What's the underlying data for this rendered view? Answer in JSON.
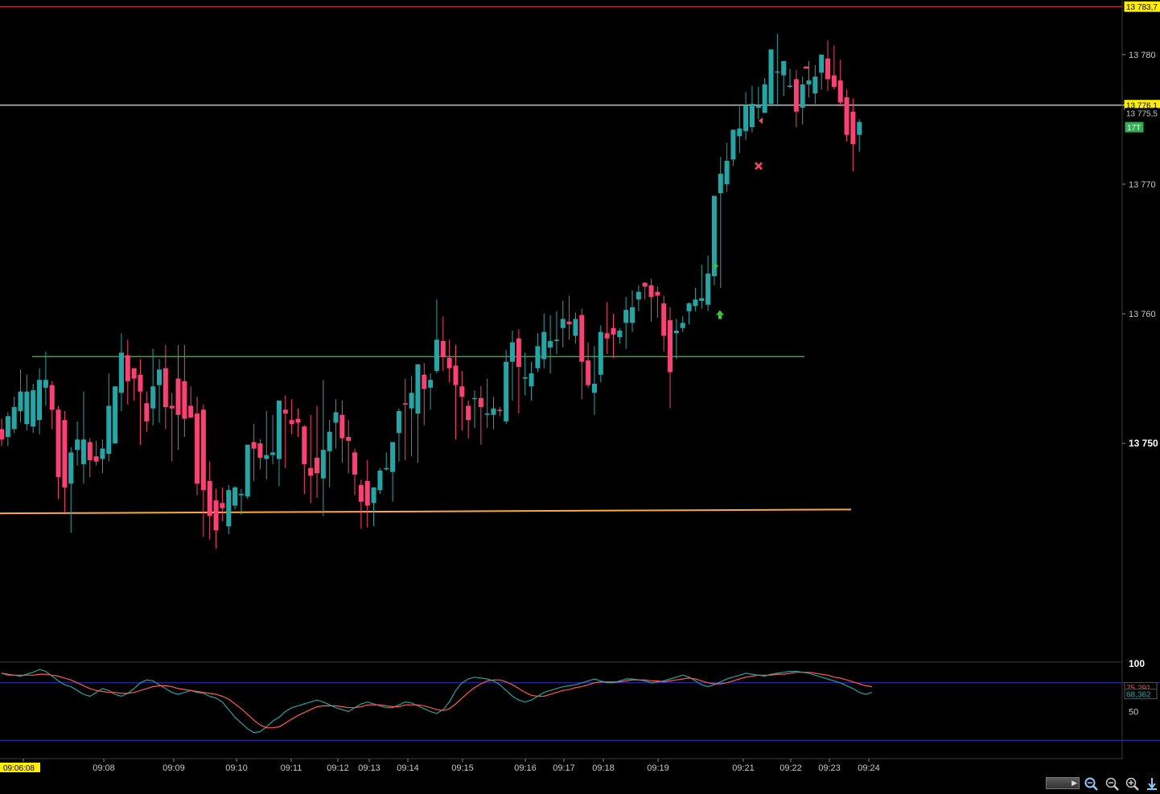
{
  "chart_data": {
    "type": "candlestick",
    "price_axis": {
      "ylim": [
        13733.5,
        13783.9
      ],
      "ticks": [
        {
          "value": 13780,
          "label": "13 780"
        },
        {
          "value": 13770,
          "label": "13 770"
        },
        {
          "value": 13760,
          "label": "13 760"
        },
        {
          "value": 13750,
          "label": "13 750",
          "bold": true
        }
      ],
      "tags": [
        {
          "value": 13783.7,
          "label": "13 783,7",
          "bg": "#ffee00",
          "fg": "#000000"
        },
        {
          "value": 13776.1,
          "label": "13 776,1",
          "bg": "#ffee00",
          "fg": "#000000"
        },
        {
          "value": 13775.5,
          "label": "13 775,5",
          "bg": "#000000",
          "fg": "#c8c8c8"
        },
        {
          "value": 13774.4,
          "label": "17T",
          "bg": "#33aa55",
          "fg": "#ffffff"
        }
      ]
    },
    "time_axis": {
      "labels": [
        "09:06:08",
        "09:08",
        "09:09",
        "09:10",
        "09:11",
        "09:12",
        "09:13",
        "09:14",
        "09:15",
        "09:16",
        "09:17",
        "09:18",
        "09:19",
        "09:21",
        "09:22",
        "09:23",
        "09:24"
      ],
      "first_label_bg": "#ffee00"
    },
    "candles": [
      [
        13751.1,
        13751.9,
        13749.8,
        13750.3
      ],
      [
        13750.5,
        13752.4,
        13749.8,
        13752.1
      ],
      [
        13751.1,
        13753.6,
        13750.8,
        13752.8
      ],
      [
        13752.5,
        13755.7,
        13751.6,
        13754.0
      ],
      [
        13751.5,
        13755.3,
        13751.0,
        13754.0
      ],
      [
        13751.3,
        13754.6,
        13750.8,
        13754.1
      ],
      [
        13751.8,
        13755.8,
        13750.7,
        13754.9
      ],
      [
        13754.3,
        13757.1,
        13752.9,
        13754.9
      ],
      [
        13754.5,
        13754.8,
        13751.1,
        13752.6
      ],
      [
        13752.6,
        13752.9,
        13745.7,
        13747.4
      ],
      [
        13751.8,
        13752.5,
        13744.7,
        13746.6
      ],
      [
        13746.9,
        13749.7,
        13743.1,
        13749.3
      ],
      [
        13749.5,
        13751.7,
        13748.3,
        13750.3
      ],
      [
        13748.4,
        13754.0,
        13746.9,
        13750.3
      ],
      [
        13750.1,
        13750.4,
        13747.4,
        13748.7
      ],
      [
        13749.0,
        13750.2,
        13748.3,
        13748.6
      ],
      [
        13748.8,
        13750.3,
        13747.7,
        13749.6
      ],
      [
        13749.2,
        13755.4,
        13748.6,
        13752.9
      ],
      [
        13750.0,
        13754.3,
        13750.0,
        13754.4
      ],
      [
        13753.9,
        13758.5,
        13752.5,
        13757.0
      ],
      [
        13756.8,
        13758.0,
        13753.0,
        13754.8
      ],
      [
        13755.8,
        13755.8,
        13753.3,
        13755.0
      ],
      [
        13755.3,
        13756.5,
        13749.9,
        13754.0
      ],
      [
        13753.1,
        13754.0,
        13750.9,
        13751.7
      ],
      [
        13752.7,
        13757.3,
        13751.4,
        13754.4
      ],
      [
        13754.5,
        13756.5,
        13751.6,
        13755.7
      ],
      [
        13755.8,
        13757.6,
        13751.1,
        13752.8
      ],
      [
        13752.9,
        13753.9,
        13748.6,
        13752.7
      ],
      [
        13755.0,
        13757.6,
        13749.5,
        13752.2
      ],
      [
        13754.8,
        13757.6,
        13750.5,
        13751.9
      ],
      [
        13752.9,
        13754.4,
        13752.0,
        13752.0
      ],
      [
        13752.3,
        13753.6,
        13746.0,
        13746.9
      ],
      [
        13752.6,
        13753.0,
        13742.8,
        13746.4
      ],
      [
        13747.1,
        13748.6,
        13742.6,
        13744.4
      ],
      [
        13745.6,
        13746.5,
        13741.9,
        13743.3
      ],
      [
        13745.4,
        13746.6,
        13744.0,
        13745.0
      ],
      [
        13743.6,
        13746.8,
        13743.0,
        13746.4
      ],
      [
        13745.2,
        13746.7,
        13744.9,
        13746.6
      ],
      [
        13746.0,
        13746.5,
        13744.5,
        13746.1
      ],
      [
        13745.9,
        13748.3,
        13745.7,
        13749.9
      ],
      [
        13750.1,
        13751.5,
        13747.1,
        13749.6
      ],
      [
        13750.0,
        13750.3,
        13748.0,
        13748.9
      ],
      [
        13748.8,
        13752.5,
        13747.2,
        13749.1
      ],
      [
        13749.1,
        13752.2,
        13748.4,
        13749.3
      ],
      [
        13748.8,
        13753.2,
        13746.7,
        13753.3
      ],
      [
        13752.6,
        13753.7,
        13748.1,
        13752.3
      ],
      [
        13751.8,
        13753.4,
        13750.7,
        13751.5
      ],
      [
        13751.9,
        13752.7,
        13750.5,
        13751.6
      ],
      [
        13751.3,
        13751.4,
        13746.1,
        13748.4
      ],
      [
        13748.1,
        13752.2,
        13745.4,
        13747.5
      ],
      [
        13748.9,
        13752.9,
        13745.8,
        13747.7
      ],
      [
        13747.3,
        13754.9,
        13744.4,
        13749.5
      ],
      [
        13749.4,
        13751.8,
        13746.6,
        13750.9
      ],
      [
        13751.6,
        13753.4,
        13749.6,
        13752.4
      ],
      [
        13752.2,
        13753.3,
        13748.5,
        13750.4
      ],
      [
        13750.5,
        13751.8,
        13747.7,
        13750.2
      ],
      [
        13749.3,
        13749.6,
        13746.0,
        13747.6
      ],
      [
        13746.8,
        13747.2,
        13743.4,
        13745.5
      ],
      [
        13747.1,
        13748.7,
        13743.5,
        13745.2
      ],
      [
        13745.4,
        13746.5,
        13743.6,
        13746.6
      ],
      [
        13746.4,
        13748.1,
        13746.1,
        13747.9
      ],
      [
        13748.0,
        13749.3,
        13747.9,
        13748.1
      ],
      [
        13747.8,
        13750.1,
        13745.5,
        13750.1
      ],
      [
        13750.8,
        13752.7,
        13748.6,
        13752.5
      ],
      [
        13753.1,
        13755.0,
        13748.7,
        13753.0
      ],
      [
        13752.7,
        13755.2,
        13749.0,
        13753.9
      ],
      [
        13752.3,
        13756.1,
        13748.5,
        13756.1
      ],
      [
        13755.3,
        13756.2,
        13751.4,
        13754.2
      ],
      [
        13754.3,
        13755.4,
        13752.6,
        13754.9
      ],
      [
        13755.6,
        13761.1,
        13755.4,
        13758.0
      ],
      [
        13757.9,
        13759.8,
        13755.6,
        13756.7
      ],
      [
        13756.6,
        13758.0,
        13754.7,
        13755.8
      ],
      [
        13756.0,
        13757.6,
        13750.3,
        13754.5
      ],
      [
        13754.4,
        13755.6,
        13751.0,
        13753.6
      ],
      [
        13752.9,
        13753.3,
        13750.4,
        13751.8
      ],
      [
        13753.5,
        13754.1,
        13751.2,
        13753.5
      ],
      [
        13753.5,
        13754.4,
        13749.9,
        13752.8
      ],
      [
        13752.2,
        13755.0,
        13751.2,
        13752.3
      ],
      [
        13752.2,
        13753.6,
        13751.1,
        13752.7
      ],
      [
        13752.6,
        13752.8,
        13752.1,
        13752.5
      ],
      [
        13751.7,
        13757.2,
        13751.5,
        13756.3
      ],
      [
        13756.3,
        13758.7,
        13753.3,
        13757.8
      ],
      [
        13758.1,
        13758.8,
        13752.3,
        13755.9
      ],
      [
        13755.0,
        13757.0,
        13753.7,
        13755.1
      ],
      [
        13754.4,
        13756.3,
        13753.3,
        13755.4
      ],
      [
        13755.8,
        13758.5,
        13755.5,
        13757.5
      ],
      [
        13756.5,
        13760.0,
        13755.8,
        13758.6
      ],
      [
        13757.4,
        13759.9,
        13755.4,
        13757.9
      ],
      [
        13757.9,
        13760.2,
        13756.9,
        13758.0
      ],
      [
        13758.9,
        13761.0,
        13757.4,
        13759.6
      ],
      [
        13759.4,
        13761.4,
        13758.0,
        13759.2
      ],
      [
        13758.3,
        13760.1,
        13757.7,
        13759.6
      ],
      [
        13759.9,
        13760.4,
        13753.4,
        13756.3
      ],
      [
        13756.4,
        13757.8,
        13754.3,
        13754.5
      ],
      [
        13753.9,
        13757.5,
        13752.2,
        13754.6
      ],
      [
        13755.3,
        13759.1,
        13754.7,
        13758.6
      ],
      [
        13758.5,
        13760.9,
        13756.9,
        13758.1
      ],
      [
        13758.9,
        13760.0,
        13756.6,
        13758.4
      ],
      [
        13758.2,
        13758.9,
        13757.7,
        13758.7
      ],
      [
        13759.3,
        13761.3,
        13757.3,
        13760.3
      ],
      [
        13759.3,
        13761.8,
        13758.6,
        13760.5
      ],
      [
        13761.1,
        13762.2,
        13760.2,
        13761.7
      ],
      [
        13762.4,
        13762.2,
        13761.1,
        13762.1
      ],
      [
        13762.2,
        13762.7,
        13759.4,
        13761.3
      ],
      [
        13761.7,
        13762.1,
        13759.7,
        13761.4
      ],
      [
        13760.8,
        13761.4,
        13757.1,
        13758.3
      ],
      [
        13759.5,
        13760.5,
        13752.7,
        13755.5
      ],
      [
        13758.5,
        13759.6,
        13756.5,
        13758.7
      ],
      [
        13758.9,
        13759.8,
        13758.6,
        13759.3
      ],
      [
        13760.2,
        13760.9,
        13759.2,
        13760.8
      ],
      [
        13760.6,
        13762.0,
        13760.2,
        13761.1
      ],
      [
        13761.0,
        13763.8,
        13760.4,
        13761.2
      ],
      [
        13760.7,
        13764.5,
        13760.2,
        13763.1
      ],
      [
        13762.9,
        13766.3,
        13762.2,
        13769.1
      ],
      [
        13769.3,
        13772.1,
        13762.0,
        13770.8
      ],
      [
        13770.0,
        13773.2,
        13769.4,
        13771.8
      ],
      [
        13771.9,
        13773.2,
        13771.4,
        13774.2
      ],
      [
        13773.7,
        13776.0,
        13772.4,
        13774.3
      ],
      [
        13774.1,
        13777.1,
        13773.4,
        13776.1
      ],
      [
        13774.4,
        13777.6,
        13774.0,
        13776.2
      ],
      [
        13775.9,
        13777.5,
        13775.0,
        13776.1
      ],
      [
        13775.5,
        13778.2,
        13775.5,
        13777.7
      ],
      [
        13776.2,
        13778.3,
        13776.0,
        13780.4
      ],
      [
        13778.7,
        13781.6,
        13776.0,
        13778.7
      ],
      [
        13778.4,
        13779.3,
        13776.8,
        13779.5
      ],
      [
        13777.6,
        13778.9,
        13777.4,
        13777.6
      ],
      [
        13778.1,
        13778.8,
        13774.4,
        13775.6
      ],
      [
        13775.9,
        13778.3,
        13774.6,
        13777.7
      ],
      [
        13777.7,
        13779.5,
        13776.7,
        13778.0
      ],
      [
        13777.0,
        13779.2,
        13776.2,
        13778.3
      ],
      [
        13778.6,
        13779.3,
        13777.3,
        13780.0
      ],
      [
        13779.7,
        13781.1,
        13777.2,
        13778.1
      ],
      [
        13778.4,
        13780.7,
        13777.3,
        13777.5
      ],
      [
        13778.0,
        13779.6,
        13776.0,
        13776.3
      ],
      [
        13776.7,
        13777.3,
        13773.3,
        13773.8
      ],
      [
        13775.6,
        13776.6,
        13771.0,
        13773.1
      ],
      [
        13773.8,
        13775.0,
        13772.5,
        13774.8
      ]
    ],
    "hlines": [
      {
        "name": "support-green",
        "y": 13756.7,
        "x_from": 40,
        "x_to": 1000,
        "color": "#33cc33"
      },
      {
        "name": "support-orange",
        "y": 13744.6,
        "y_end": 13744.9,
        "x_from": 0,
        "x_to": 1058,
        "color": "#ffaa33"
      },
      {
        "name": "top-line",
        "y": 13783.7,
        "x_from": 0,
        "x_to": 1396,
        "color": "#cc3333"
      },
      {
        "name": "price-line",
        "y": 13776.1,
        "x_from": 0,
        "x_to": 1442,
        "color": "#cccccc"
      }
    ],
    "oscillator": {
      "ylim": [
        0,
        100
      ],
      "levels": [
        80,
        20
      ],
      "labels": [
        {
          "value": 100,
          "label": "100",
          "fg": "#ffffff"
        },
        {
          "value": 50,
          "label": "50",
          "fg": "#c8c8c8"
        }
      ],
      "value_tags": [
        {
          "value": 75.291,
          "label": "75,291",
          "color": "#e05050"
        },
        {
          "value": 68.362,
          "label": "68,362",
          "color": "#2aa8a8"
        }
      ],
      "series": [
        {
          "color": "#1fa3a3",
          "values": [
            90,
            88,
            88,
            87,
            89,
            91,
            94,
            92,
            87,
            82,
            78,
            76,
            72,
            68,
            66,
            70,
            74,
            72,
            68,
            66,
            69,
            74,
            80,
            83,
            82,
            78,
            74,
            70,
            68,
            70,
            72,
            70,
            69,
            66,
            64,
            60,
            52,
            44,
            38,
            32,
            28,
            29,
            34,
            40,
            44,
            50,
            54,
            56,
            58,
            60,
            62,
            60,
            57,
            54,
            52,
            50,
            54,
            58,
            60,
            58,
            56,
            54,
            54,
            57,
            60,
            59,
            56,
            53,
            50,
            48,
            52,
            60,
            72,
            80,
            84,
            86,
            85,
            84,
            82,
            78,
            72,
            66,
            62,
            60,
            62,
            66,
            70,
            72,
            74,
            76,
            77,
            78,
            80,
            82,
            84,
            82,
            80,
            80,
            82,
            84,
            84,
            83,
            82,
            80,
            81,
            82,
            84,
            86,
            88,
            86,
            82,
            78,
            76,
            78,
            81,
            84,
            86,
            88,
            90,
            89,
            88,
            87,
            89,
            90,
            91,
            92,
            92,
            91,
            90,
            88,
            86,
            84,
            82,
            80,
            77,
            74,
            70,
            68,
            70
          ]
        },
        {
          "color": "#ff5a4a",
          "values": [
            90,
            89,
            88,
            88,
            88,
            88,
            89,
            89,
            88,
            87,
            85,
            83,
            80,
            77,
            74,
            72,
            71,
            70,
            70,
            69,
            69,
            70,
            72,
            74,
            76,
            77,
            77,
            76,
            74,
            73,
            72,
            71,
            70,
            69,
            68,
            66,
            63,
            58,
            53,
            47,
            41,
            36,
            33,
            33,
            34,
            38,
            42,
            46,
            49,
            52,
            55,
            56,
            56,
            56,
            55,
            54,
            54,
            55,
            57,
            57,
            57,
            56,
            55,
            55,
            57,
            57,
            57,
            56,
            54,
            52,
            51,
            53,
            58,
            64,
            70,
            75,
            79,
            82,
            83,
            83,
            81,
            78,
            74,
            70,
            67,
            66,
            66,
            68,
            70,
            72,
            73,
            75,
            76,
            78,
            80,
            81,
            81,
            81,
            81,
            82,
            83,
            83,
            83,
            82,
            82,
            81,
            82,
            83,
            84,
            85,
            84,
            82,
            80,
            79,
            79,
            80,
            82,
            84,
            86,
            87,
            88,
            88,
            88,
            89,
            89,
            90,
            91,
            91,
            91,
            90,
            89,
            88,
            86,
            85,
            83,
            81,
            79,
            77,
            76
          ]
        }
      ]
    },
    "markers": [
      {
        "type": "right-triangle",
        "name": "signal-triangle",
        "x": 890,
        "y": 13763.7,
        "color": "#33cc33"
      },
      {
        "type": "up-arrow",
        "name": "buy-arrow",
        "x": 895,
        "y": 13759.9,
        "color": "#33cc33"
      },
      {
        "type": "cross",
        "name": "exit-cross",
        "x": 943,
        "y": 13771.4,
        "color": "#ff4466"
      },
      {
        "type": "left-triangle",
        "name": "signal-left-triangle",
        "x": 946,
        "y": 13774.9,
        "color": "#ff4466"
      },
      {
        "type": "dash",
        "name": "level-dash",
        "x": 1002,
        "y": 13779.0,
        "color": "#ff4466"
      }
    ],
    "colors": {
      "up": "#20a8a8",
      "down": "#ff3f73",
      "grid_line": "#3a3a3a",
      "axis_text": "#c8c8c8",
      "level_line": "#3030d0"
    }
  },
  "toolbar": {
    "zoom_fit_icon": "zoom-fit-icon",
    "zoom_out_icon": "zoom-out-icon",
    "zoom_in_icon": "zoom-in-icon",
    "scroll_down_icon": "scroll-down-icon"
  }
}
